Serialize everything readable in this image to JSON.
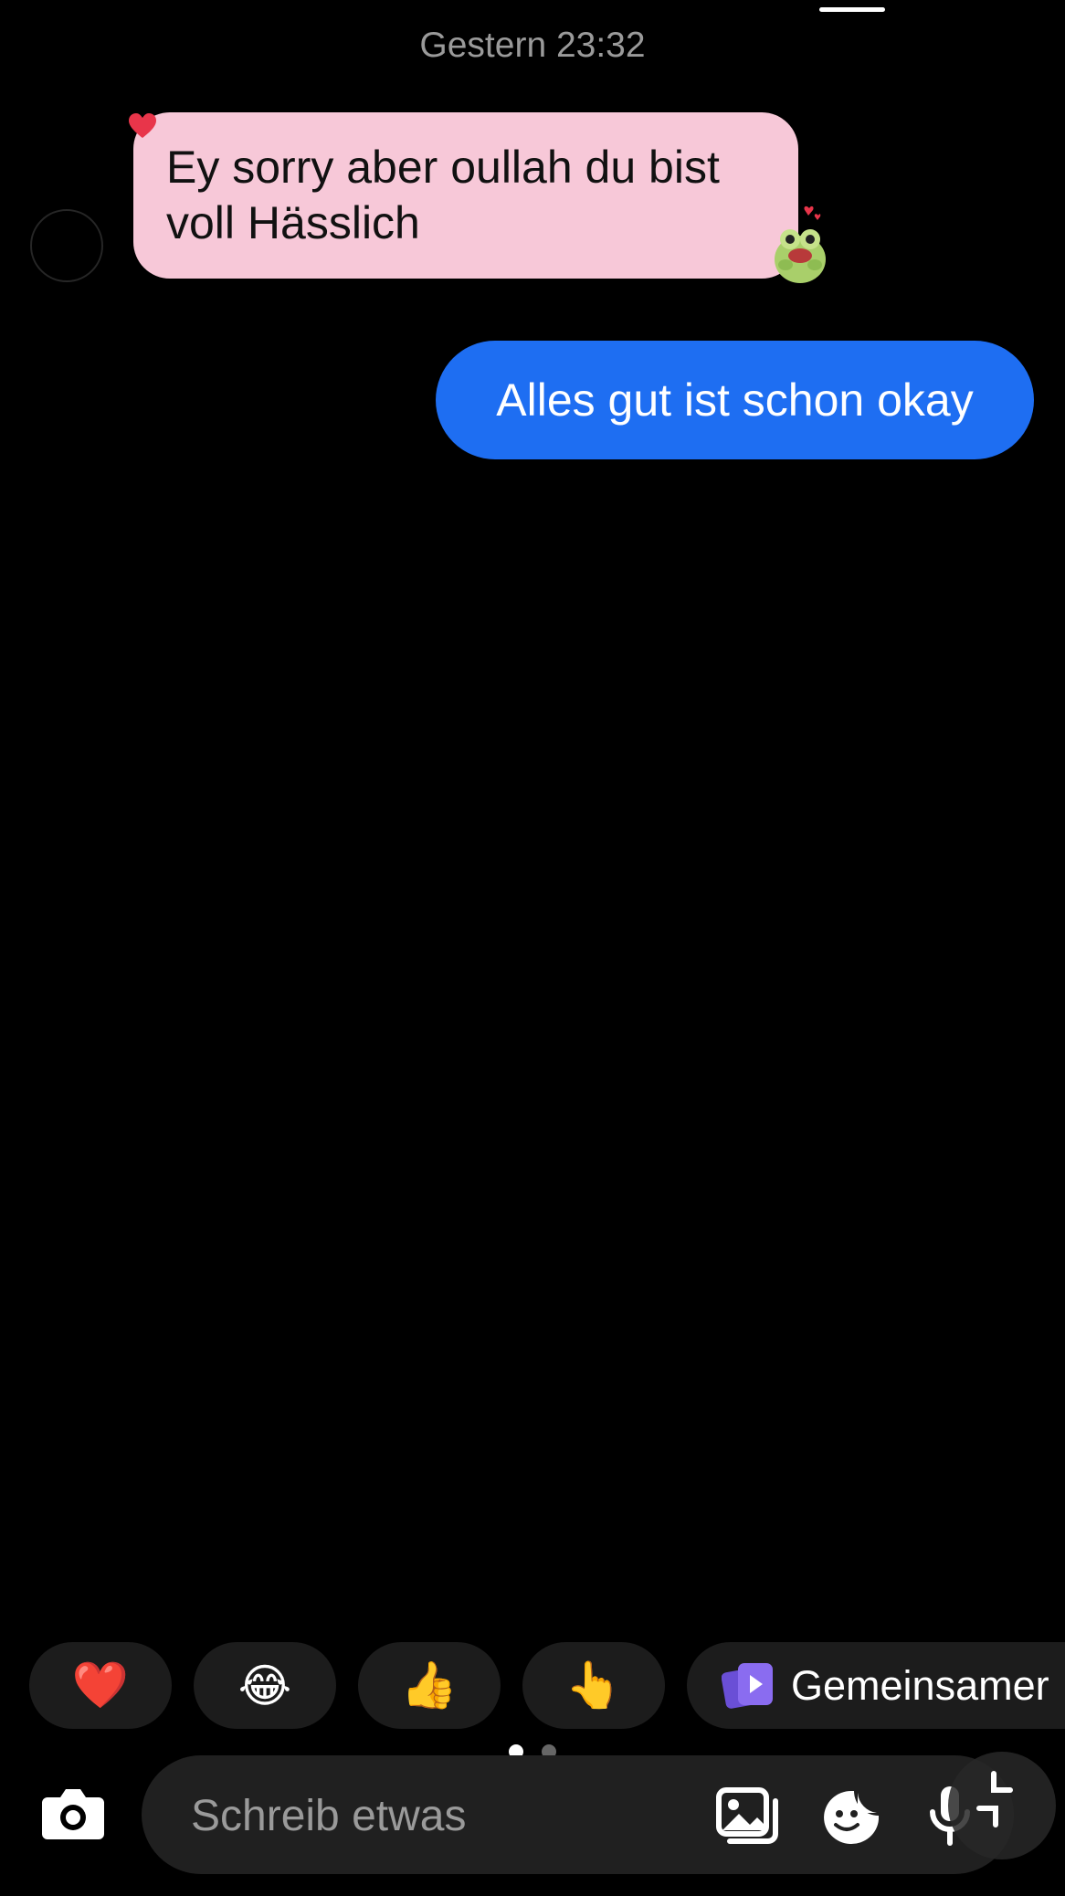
{
  "timestamp": "Gestern 23:32",
  "messages": {
    "incoming": {
      "line1": "Ey sorry aber oullah du bist",
      "line2": "voll Hässlich",
      "reaction": "heart-icon",
      "sticker": "frog-sticker-icon"
    },
    "outgoing": {
      "text": "Alles gut ist schon okay"
    }
  },
  "quick_reactions": {
    "heart": "❤️",
    "laugh": "😂",
    "thumbs": "👍",
    "point": "👆",
    "gemeinsam_label": "Gemeinsamer"
  },
  "pager": {
    "pages": 2,
    "active": 1
  },
  "composer": {
    "placeholder": "Schreib etwas",
    "icons": [
      "camera-icon",
      "gallery-icon",
      "sticker-icon",
      "microphone-icon",
      "minimize-icon"
    ]
  },
  "colors": {
    "incoming_bubble": "#f7c8d8",
    "outgoing_bubble": "#1e6ef2",
    "background": "#000000"
  }
}
